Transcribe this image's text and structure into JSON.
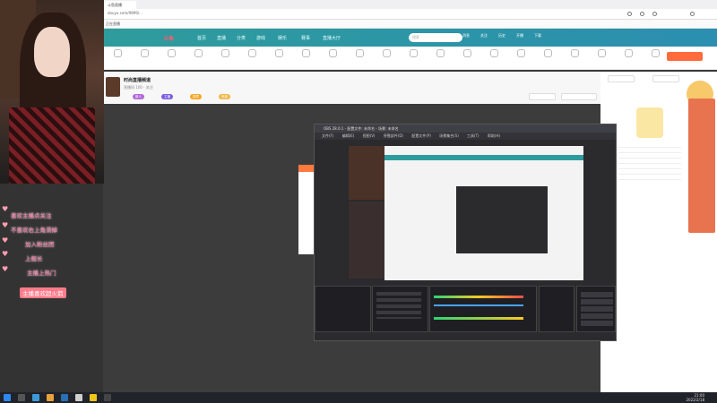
{
  "browser": {
    "tab_label": "斗鱼直播",
    "url": "douyu.com/9999/...",
    "bookmark": "正在直播"
  },
  "site": {
    "logo": "斗鱼",
    "nav": [
      "首页",
      "直播",
      "分类",
      "游戏",
      "娱乐",
      "赛事",
      "直播大厅"
    ],
    "search_placeholder": "搜索",
    "header_icons": [
      "消息",
      "关注",
      "历史",
      "开播",
      "下载"
    ]
  },
  "room": {
    "title": "时尚直播频道",
    "subtitle": "直播间 100 · 关注",
    "badges": [
      "新人",
      "主播",
      "勋章",
      "贵族"
    ],
    "badge_colors": [
      "#b06ad6",
      "#7a5de0",
      "#f5a623",
      "#f0b84c"
    ]
  },
  "chat": {
    "lines": [
      "喜欢主播点关注",
      "不喜欢右上角滑掉",
      "加入粉丝团",
      "上舰长",
      "主播上热门",
      "主播喜欢超火箭"
    ]
  },
  "obs": {
    "window_title": "OBS 28.0.1 - 配置文件: 未命名 - 场景: 未命名",
    "menu": [
      "文件(F)",
      "编辑(E)",
      "视图(V)",
      "停靠部件(D)",
      "配置文件(P)",
      "场景集合(S)",
      "工具(T)",
      "帮助(H)"
    ]
  },
  "taskbar": {
    "time": "21:00",
    "date": "2022/2/18"
  }
}
